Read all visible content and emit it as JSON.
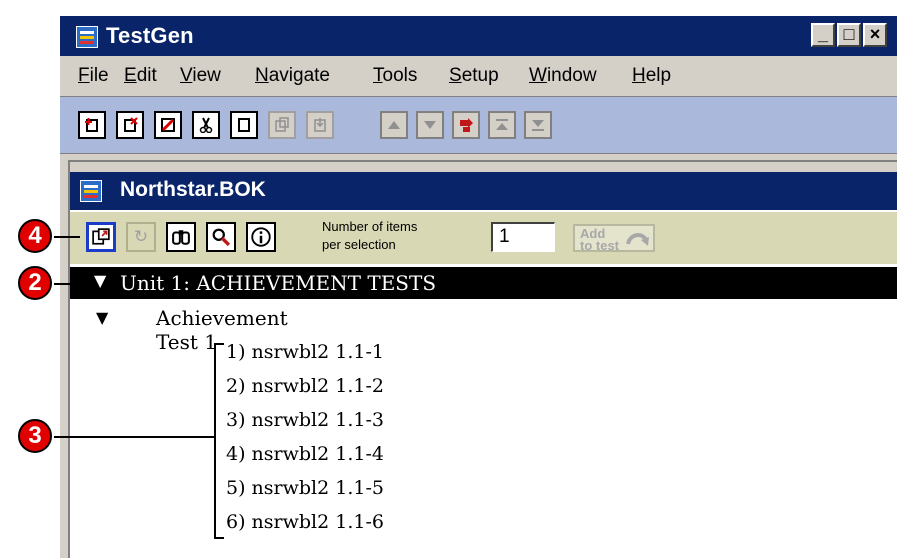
{
  "window": {
    "title": "TestGen",
    "controls": {
      "minimize": "_",
      "maximize": "□",
      "close": "×"
    }
  },
  "menu": [
    "File",
    "Edit",
    "View",
    "Navigate",
    "Tools",
    "Setup",
    "Window",
    "Help"
  ],
  "menu_accelerators": [
    "F",
    "E",
    "V",
    "N",
    "T",
    "S",
    "W",
    "H"
  ],
  "toolbar_icons": [
    "new-question-icon",
    "delete-question-icon",
    "edit-icon",
    "cut-icon",
    "copy-icon",
    "paste-icon",
    "paste-into-icon",
    "move-up-icon",
    "move-down-icon",
    "import-icon",
    "move-to-top-icon",
    "move-to-bottom-icon"
  ],
  "document": {
    "title": "Northstar.BOK",
    "toolbar_icons": [
      "open-preview-icon",
      "refresh-icon",
      "find-icon",
      "zoom-icon",
      "info-icon"
    ],
    "items_label_line1": "Number of items",
    "items_label_line2": "per selection",
    "items_value": "1",
    "add_label_line1": "Add",
    "add_label_line2": "to test"
  },
  "tree": {
    "unit": "Unit 1: ACHIEVEMENT TESTS",
    "test": "Achievement Test 1",
    "items": [
      "1) nsrwbl2 1.1-1",
      "2) nsrwbl2 1.1-2",
      "3) nsrwbl2 1.1-3",
      "4) nsrwbl2 1.1-4",
      "5) nsrwbl2 1.1-5",
      "6) nsrwbl2 1.1-6"
    ]
  },
  "callouts": {
    "a": "4",
    "b": "2",
    "c": "3"
  },
  "colors": {
    "title_bar": "#0a246a",
    "toolbar": "#aab8dc",
    "doc_toolbar": "#d8d8b4",
    "callout": "#e00000",
    "focus": "#1a3cc8"
  }
}
